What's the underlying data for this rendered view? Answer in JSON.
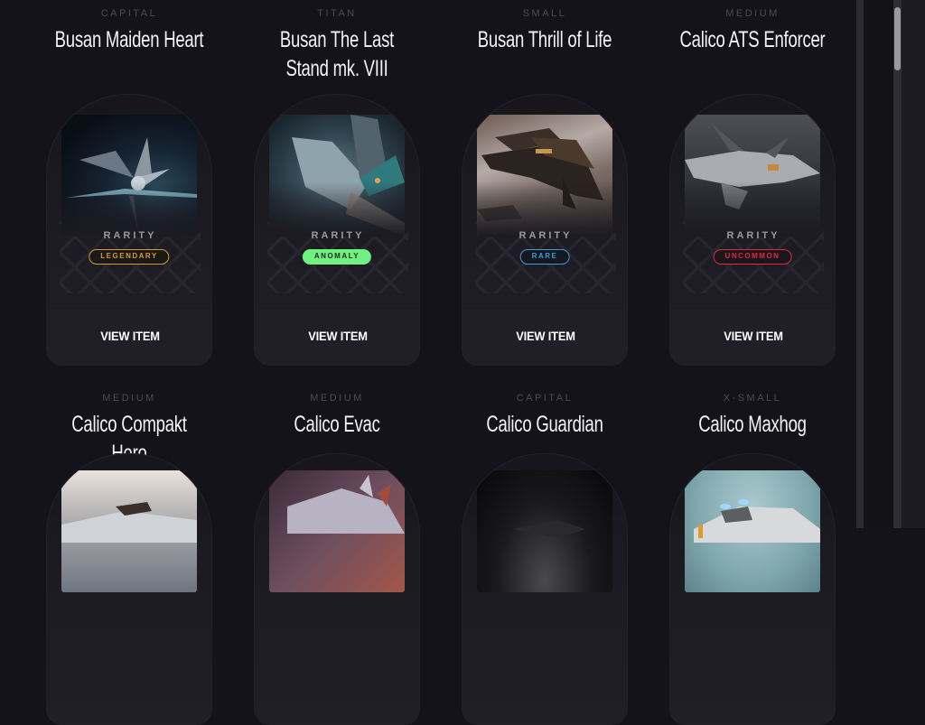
{
  "items": [
    {
      "size": "CAPITAL",
      "name": "Busan Maiden Heart",
      "rarity_label": "RARITY",
      "rarity": "LEGENDARY",
      "rarity_color": "#d49a3a",
      "badge_style": "outline",
      "action": "VIEW ITEM",
      "image": "ship-space-blue"
    },
    {
      "size": "TITAN",
      "name": "Busan The Last Stand mk. VIII",
      "rarity_label": "RARITY",
      "rarity": "ANOMALY",
      "rarity_color": "#6ff07f",
      "badge_style": "filled",
      "action": "VIEW ITEM",
      "image": "ship-teal-wreck"
    },
    {
      "size": "SMALL",
      "name": "Busan Thrill of Life",
      "rarity_label": "RARITY",
      "rarity": "RARE",
      "rarity_color": "#3d9ad6",
      "badge_style": "outline",
      "action": "VIEW ITEM",
      "image": "ship-desert-bronze"
    },
    {
      "size": "MEDIUM",
      "name": "Calico ATS Enforcer",
      "rarity_label": "RARITY",
      "rarity": "UNCOMMON",
      "rarity_color": "#e2283d",
      "badge_style": "outline",
      "action": "VIEW ITEM",
      "image": "ship-grey-gunship"
    },
    {
      "size": "MEDIUM",
      "name": "Calico Compakt Hero",
      "image": "ship-sky-white"
    },
    {
      "size": "MEDIUM",
      "name": "Calico Evac",
      "image": "ship-purple-nebula"
    },
    {
      "size": "CAPITAL",
      "name": "Calico Guardian",
      "image": "ship-dark-smoke"
    },
    {
      "size": "X-SMALL",
      "name": "Calico Maxhog",
      "image": "ship-ice-blue"
    }
  ],
  "scrollbar": {
    "position_fraction": 0.0
  }
}
